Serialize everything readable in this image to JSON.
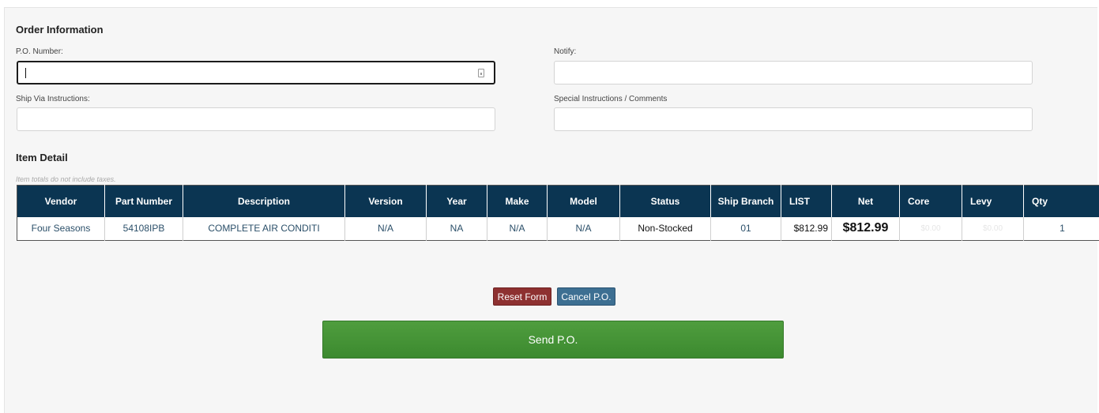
{
  "order_info": {
    "title": "Order Information",
    "po_number_label": "P.O. Number:",
    "po_number_value": "",
    "notify_label": "Notify:",
    "notify_value": "",
    "ship_via_label": "Ship Via Instructions:",
    "ship_via_value": "",
    "special_label": "Special Instructions / Comments",
    "special_value": ""
  },
  "item_detail": {
    "title": "Item Detail",
    "note": "Item totals do not include taxes.",
    "columns": [
      "Vendor",
      "Part Number",
      "Description",
      "Version",
      "Year",
      "Make",
      "Model",
      "Status",
      "Ship Branch",
      "LIST",
      "Net",
      "Core",
      "Levy",
      "Qty"
    ],
    "rows": [
      {
        "vendor": "Four Seasons",
        "part_number": "54108IPB",
        "description": "COMPLETE AIR CONDITI",
        "version": "N/A",
        "year": "NA",
        "make": "N/A",
        "model": "N/A",
        "status": "Non-Stocked",
        "ship_branch": "01",
        "list": "$812.99",
        "net": "$812.99",
        "core": "$0.00",
        "levy": "$0.00",
        "qty": "1"
      }
    ]
  },
  "actions": {
    "reset_label": "Reset Form",
    "cancel_label": "Cancel P.O.",
    "send_label": "Send P.O."
  },
  "colors": {
    "header_bg": "#0b3552",
    "reset_bg": "#8e3131",
    "cancel_bg": "#3d6f92",
    "send_bg": "#469436"
  },
  "icons": {
    "po_field_icon": "clipboard-icon"
  }
}
